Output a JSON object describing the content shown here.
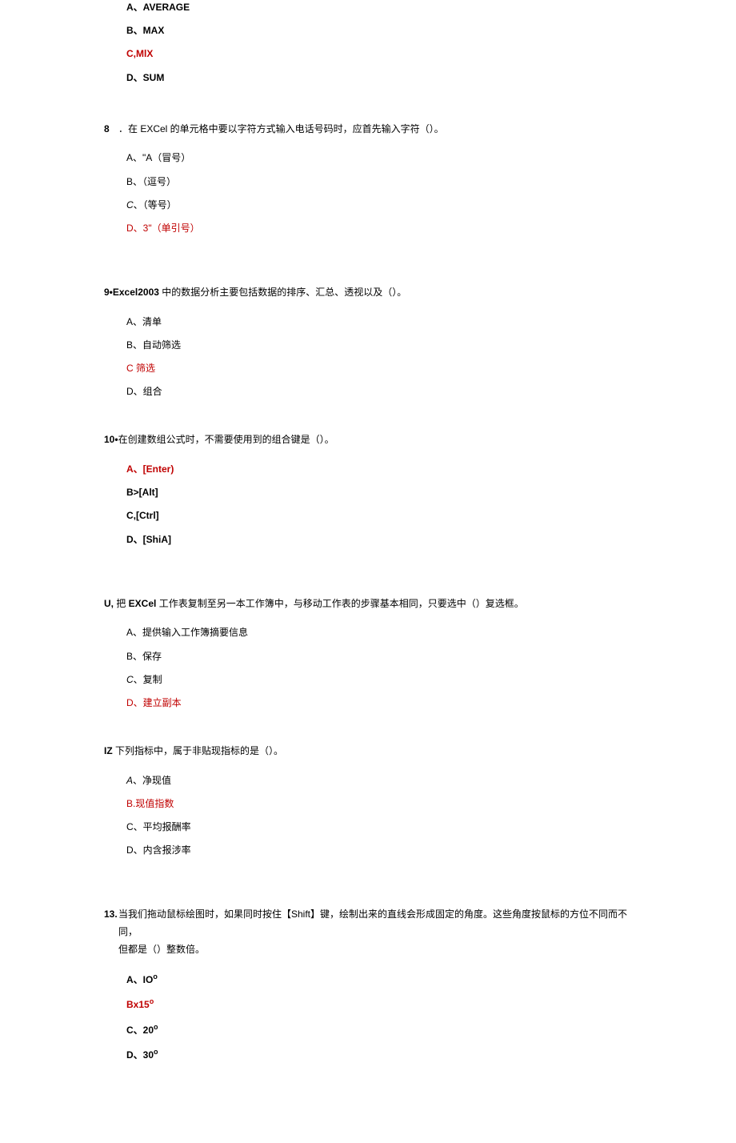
{
  "q7": {
    "optA": "A、AVERAGE",
    "optB": "B、MAX",
    "optC": "C,MlX",
    "optD": "D、SUM"
  },
  "q8": {
    "num": "8",
    "stem": "．在 EXCel 的单元格中要以字符方式输入电话号码时，应首先输入字符（）。",
    "optA": "A、\"A（冒号）",
    "optB": "B、（逗号）",
    "optC": "C、（等号）",
    "optD": "D、3\"（单引号）"
  },
  "q9": {
    "num": "9•",
    "stem": "Excel2003 中的数据分析主要包括数据的排序、汇总、透视以及（）。",
    "optA": "A、清单",
    "optB": "B、自动筛选",
    "optC": "C 筛选",
    "optD": "D、组合"
  },
  "q10": {
    "num": "10•",
    "stem": "在创建数组公式时，不需要使用到的组合键是（）。",
    "optA": "A、[Enter)",
    "optB": "B>[Alt]",
    "optC": "C,[Ctrl]",
    "optD": "D、[ShiA]"
  },
  "q11": {
    "num": "U,",
    "stem": "把 EXCel 工作表复制至另一本工作簿中，与移动工作表的步骤基本相同，只要选中（）复选框。",
    "optA": "A、提供输入工作簿摘要信息",
    "optB": "B、保存",
    "optC": "C、复制",
    "optD": "D、建立副本"
  },
  "q12": {
    "num": "IZ",
    "stem": "下列指标中，属于非贴现指标的是（）。",
    "optA": "A、净现值",
    "optB": "B.现值指数",
    "optC": "C、平均报酬率",
    "optD": "D、内含报涉率"
  },
  "q13": {
    "num": "13.",
    "stem_p1": "当我们拖动鼠标绘图时，如果同时按住【Shift】键，绘制出来的直线会形成固定的角度。这些角度按鼠标的方位不同而不同，",
    "stem_p2": "但都是（）整数倍。",
    "optA_prefix": "A、IO",
    "optA_suffix": "o",
    "optB_prefix": "Bx15",
    "optB_suffix": "o",
    "optC_prefix": "C、20",
    "optC_suffix": "o",
    "optD_prefix": "D、30",
    "optD_suffix": "o"
  }
}
